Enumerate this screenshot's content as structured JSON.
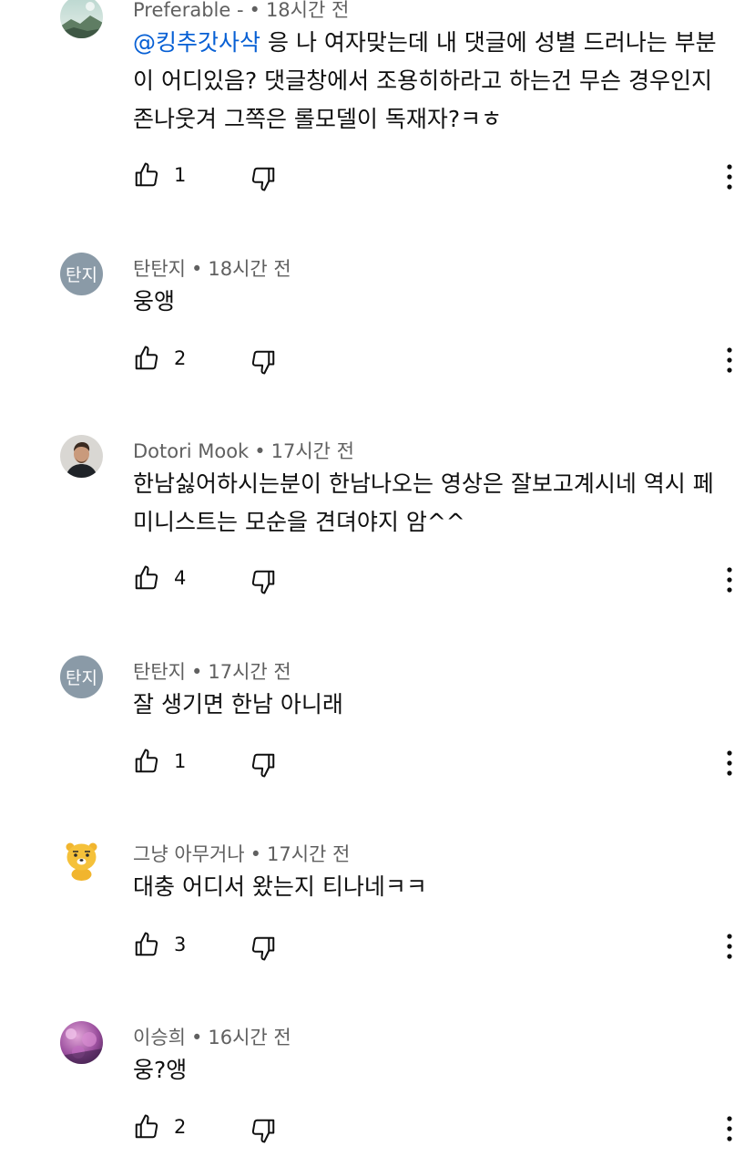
{
  "comments": [
    {
      "author": "Preferable -",
      "time": "18시간 전",
      "mention": "@킹추갓사삭",
      "text": "응 나 여자맞는데 내 댓글에 성별 드러나는 부분이 어디있음? 댓글창에서 조용히하라고 하는건 무슨 경우인지 존나웃겨 그쪽은 롤모델이 독재자?ㅋㅎ",
      "likes": "1",
      "avatar_icon": "landscape-avatar"
    },
    {
      "author": "탄탄지",
      "time": "18시간 전",
      "avatar_text": "탄지",
      "text": "웅앵",
      "likes": "2"
    },
    {
      "author": "Dotori Mook",
      "time": "17시간 전",
      "text": "한남싫어하시는분이 한남나오는 영상은 잘보고계시네 역시 페미니스트는 모순을 견뎌야지 암^^",
      "likes": "4",
      "avatar_icon": "person-photo-avatar"
    },
    {
      "author": "탄탄지",
      "time": "17시간 전",
      "avatar_text": "탄지",
      "text": "잘 생기면 한남 아니래",
      "likes": "1"
    },
    {
      "author": "그냥 아무거나",
      "time": "17시간 전",
      "text": "대충 어디서 왔는지 티나네ㅋㅋ",
      "likes": "3",
      "avatar_icon": "lion-character-avatar"
    },
    {
      "author": "이승희",
      "time": "16시간 전",
      "text": "웅?앵",
      "likes": "2",
      "avatar_icon": "purple-flower-avatar"
    }
  ],
  "icons": {
    "like": "thumbs-up-icon",
    "dislike": "thumbs-down-icon",
    "more": "more-vertical-icon"
  },
  "colors": {
    "mention": "#065fd4",
    "meta": "#606060",
    "text": "#0f0f0f",
    "avatar_bg": "#8a9aa7"
  }
}
